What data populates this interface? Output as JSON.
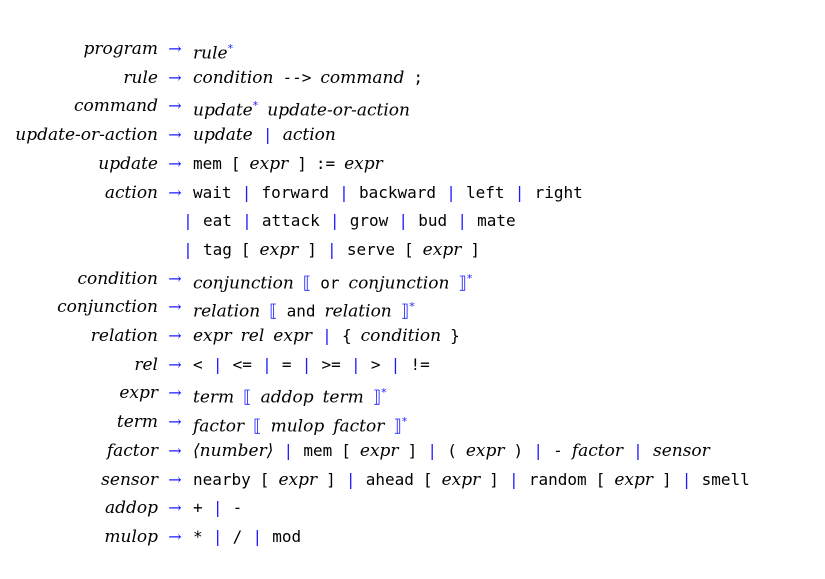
{
  "grammar": {
    "arrow": "→",
    "alt": "|",
    "star": "*",
    "open_rep": "⟦",
    "close_rep": "⟧",
    "rules": [
      {
        "lhs": "program",
        "rhs": [
          [
            "nt",
            "rule"
          ],
          [
            "star",
            "*"
          ]
        ]
      },
      {
        "lhs": "rule",
        "rhs": [
          [
            "nt",
            "condition"
          ],
          [
            "tt",
            "-->"
          ],
          [
            "nt",
            "command"
          ],
          [
            "tt",
            ";"
          ]
        ]
      },
      {
        "lhs": "command",
        "rhs": [
          [
            "nt",
            "update"
          ],
          [
            "star",
            "*"
          ],
          [
            "nt",
            "update-or-action"
          ]
        ]
      },
      {
        "lhs": "update-or-action",
        "rhs": [
          [
            "nt",
            "update"
          ],
          [
            "bar",
            "|"
          ],
          [
            "nt",
            "action"
          ]
        ]
      },
      {
        "lhs": "update",
        "rhs": [
          [
            "tt",
            "mem"
          ],
          [
            "tt",
            "["
          ],
          [
            "nt",
            "expr"
          ],
          [
            "tt",
            "]"
          ],
          [
            "tt",
            ":="
          ],
          [
            "nt",
            "expr"
          ]
        ]
      },
      {
        "lhs": "action",
        "rhs": [
          [
            "tt",
            "wait"
          ],
          [
            "bar",
            "|"
          ],
          [
            "tt",
            "forward"
          ],
          [
            "bar",
            "|"
          ],
          [
            "tt",
            "backward"
          ],
          [
            "bar",
            "|"
          ],
          [
            "tt",
            "left"
          ],
          [
            "bar",
            "|"
          ],
          [
            "tt",
            "right"
          ]
        ]
      },
      {
        "lhs": "",
        "cont": true,
        "rhs": [
          [
            "bar",
            "|"
          ],
          [
            "tt",
            "eat"
          ],
          [
            "bar",
            "|"
          ],
          [
            "tt",
            "attack"
          ],
          [
            "bar",
            "|"
          ],
          [
            "tt",
            "grow"
          ],
          [
            "bar",
            "|"
          ],
          [
            "tt",
            "bud"
          ],
          [
            "bar",
            "|"
          ],
          [
            "tt",
            "mate"
          ]
        ]
      },
      {
        "lhs": "",
        "cont": true,
        "rhs": [
          [
            "bar",
            "|"
          ],
          [
            "tt",
            "tag"
          ],
          [
            "tt",
            "["
          ],
          [
            "nt",
            "expr"
          ],
          [
            "tt",
            "]"
          ],
          [
            "bar",
            "|"
          ],
          [
            "tt",
            "serve"
          ],
          [
            "tt",
            "["
          ],
          [
            "nt",
            "expr"
          ],
          [
            "tt",
            "]"
          ]
        ]
      },
      {
        "lhs": "condition",
        "rhs": [
          [
            "nt",
            "conjunction"
          ],
          [
            "meta",
            "⟦"
          ],
          [
            "tt",
            "or"
          ],
          [
            "nt",
            "conjunction"
          ],
          [
            "meta",
            "⟧"
          ],
          [
            "star",
            "*"
          ]
        ]
      },
      {
        "lhs": "conjunction",
        "rhs": [
          [
            "nt",
            "relation"
          ],
          [
            "meta",
            "⟦"
          ],
          [
            "tt",
            "and"
          ],
          [
            "nt",
            "relation"
          ],
          [
            "meta",
            "⟧"
          ],
          [
            "star",
            "*"
          ]
        ]
      },
      {
        "lhs": "relation",
        "rhs": [
          [
            "nt",
            "expr"
          ],
          [
            "nt",
            "rel"
          ],
          [
            "nt",
            "expr"
          ],
          [
            "bar",
            "|"
          ],
          [
            "tt",
            "{"
          ],
          [
            "nt",
            "condition"
          ],
          [
            "tt",
            "}"
          ]
        ]
      },
      {
        "lhs": "rel",
        "rhs": [
          [
            "tt",
            "<"
          ],
          [
            "bar",
            "|"
          ],
          [
            "tt",
            "<="
          ],
          [
            "bar",
            "|"
          ],
          [
            "tt",
            "="
          ],
          [
            "bar",
            "|"
          ],
          [
            "tt",
            ">="
          ],
          [
            "bar",
            "|"
          ],
          [
            "tt",
            ">"
          ],
          [
            "bar",
            "|"
          ],
          [
            "tt",
            "!="
          ]
        ]
      },
      {
        "lhs": "expr",
        "rhs": [
          [
            "nt",
            "term"
          ],
          [
            "meta",
            "⟦"
          ],
          [
            "nt",
            "addop"
          ],
          [
            "nt",
            "term"
          ],
          [
            "meta",
            "⟧"
          ],
          [
            "star",
            "*"
          ]
        ]
      },
      {
        "lhs": "term",
        "rhs": [
          [
            "nt",
            "factor"
          ],
          [
            "meta",
            "⟦"
          ],
          [
            "nt",
            "mulop"
          ],
          [
            "nt",
            "factor"
          ],
          [
            "meta",
            "⟧"
          ],
          [
            "star",
            "*"
          ]
        ]
      },
      {
        "lhs": "factor",
        "rhs": [
          [
            "nt",
            "⟨number⟩"
          ],
          [
            "bar",
            "|"
          ],
          [
            "tt",
            "mem"
          ],
          [
            "tt",
            "["
          ],
          [
            "nt",
            "expr"
          ],
          [
            "tt",
            "]"
          ],
          [
            "bar",
            "|"
          ],
          [
            "tt",
            "("
          ],
          [
            "nt",
            "expr"
          ],
          [
            "tt",
            ")"
          ],
          [
            "bar",
            "|"
          ],
          [
            "tt",
            "-"
          ],
          [
            "nt",
            "factor"
          ],
          [
            "bar",
            "|"
          ],
          [
            "nt",
            "sensor"
          ]
        ]
      },
      {
        "lhs": "sensor",
        "rhs": [
          [
            "tt",
            "nearby"
          ],
          [
            "tt",
            "["
          ],
          [
            "nt",
            "expr"
          ],
          [
            "tt",
            "]"
          ],
          [
            "bar",
            "|"
          ],
          [
            "tt",
            "ahead"
          ],
          [
            "tt",
            "["
          ],
          [
            "nt",
            "expr"
          ],
          [
            "tt",
            "]"
          ],
          [
            "bar",
            "|"
          ],
          [
            "tt",
            "random"
          ],
          [
            "tt",
            "["
          ],
          [
            "nt",
            "expr"
          ],
          [
            "tt",
            "]"
          ],
          [
            "bar",
            "|"
          ],
          [
            "tt",
            "smell"
          ]
        ]
      },
      {
        "lhs": "addop",
        "rhs": [
          [
            "tt",
            "+"
          ],
          [
            "bar",
            "|"
          ],
          [
            "tt",
            "-"
          ]
        ]
      },
      {
        "lhs": "mulop",
        "rhs": [
          [
            "tt",
            "*"
          ],
          [
            "bar",
            "|"
          ],
          [
            "tt",
            "/"
          ],
          [
            "bar",
            "|"
          ],
          [
            "tt",
            "mod"
          ]
        ]
      }
    ]
  }
}
